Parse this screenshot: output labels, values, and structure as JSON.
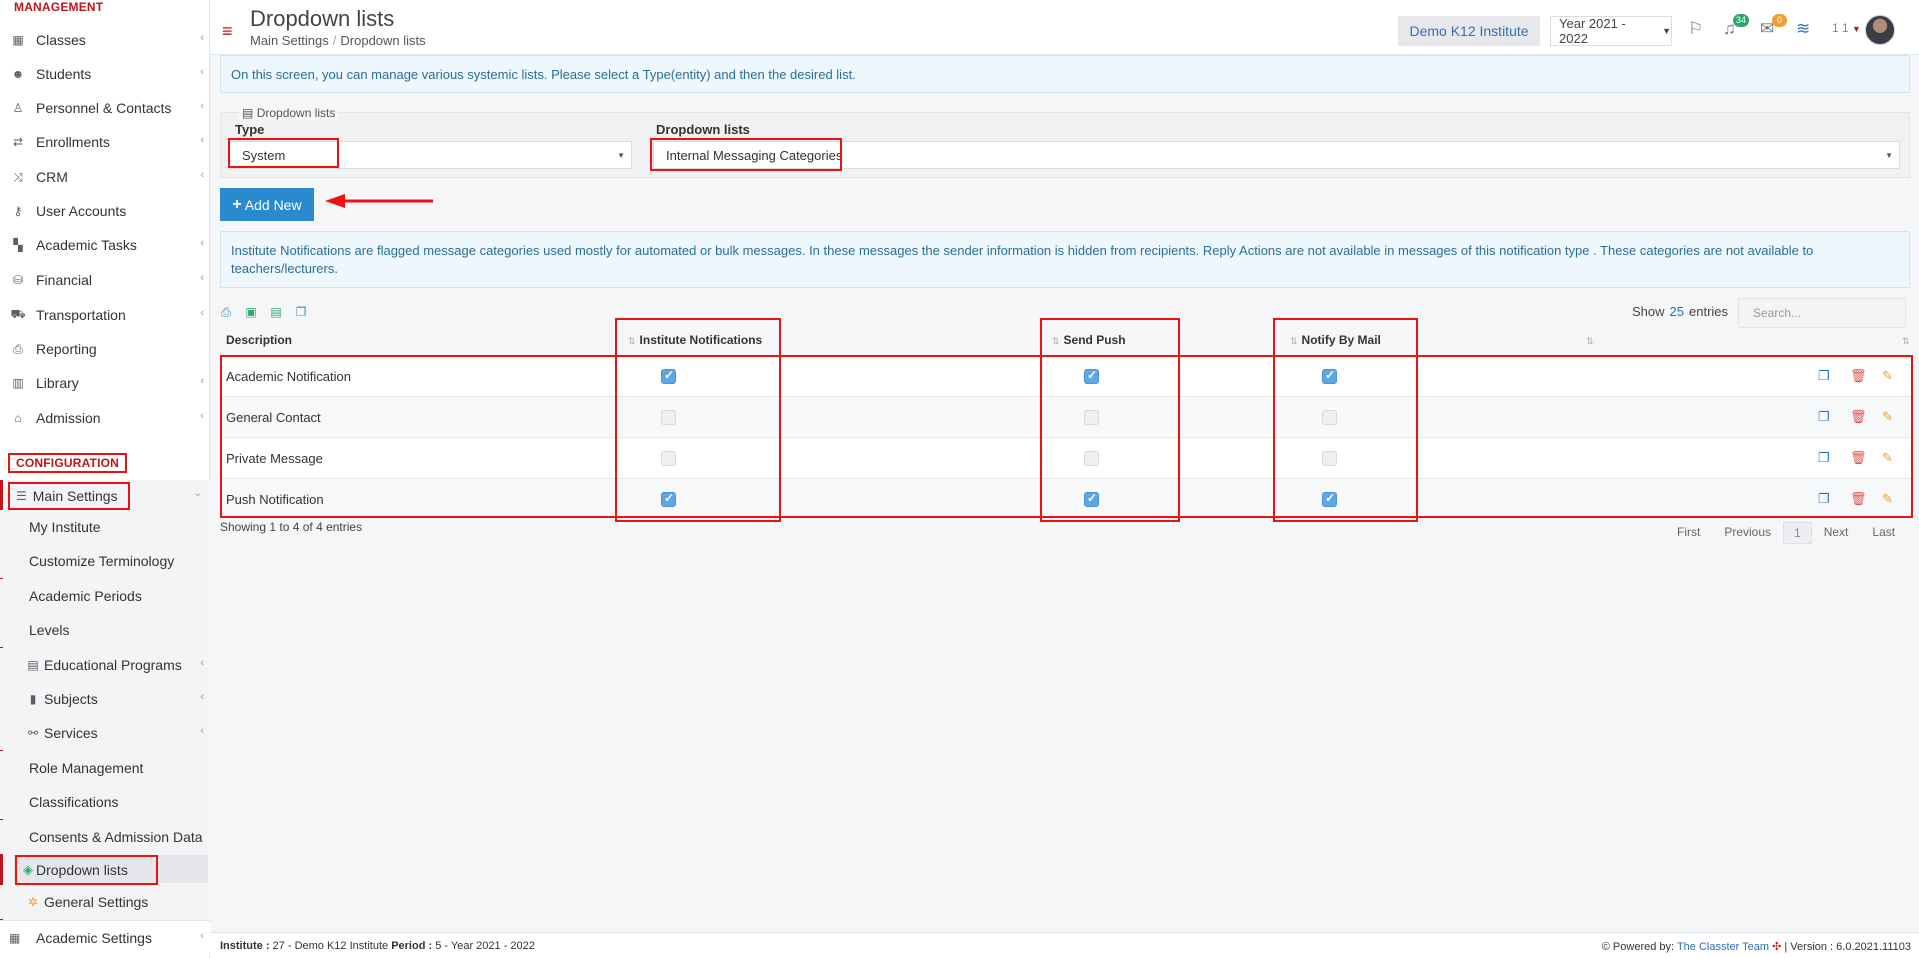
{
  "sidebar": {
    "management_label": "MANAGEMENT",
    "items": [
      {
        "label": "Classes",
        "icon": "classes-icon",
        "chev": "‹"
      },
      {
        "label": "Students",
        "icon": "students-icon",
        "chev": "‹"
      },
      {
        "label": "Personnel & Contacts",
        "icon": "person-icon",
        "chev": "‹"
      },
      {
        "label": "Enrollments",
        "icon": "exchange-icon",
        "chev": "‹"
      },
      {
        "label": "CRM",
        "icon": "crm-icon",
        "chev": "‹"
      },
      {
        "label": "User Accounts",
        "icon": "key-icon",
        "chev": ""
      },
      {
        "label": "Academic Tasks",
        "icon": "grid-icon",
        "chev": "‹"
      },
      {
        "label": "Financial",
        "icon": "money-icon",
        "chev": "‹"
      },
      {
        "label": "Transportation",
        "icon": "bus-icon",
        "chev": "‹"
      },
      {
        "label": "Reporting",
        "icon": "printer-icon",
        "chev": ""
      },
      {
        "label": "Library",
        "icon": "library-icon",
        "chev": "‹"
      },
      {
        "label": "Admission",
        "icon": "bank-icon",
        "chev": "‹"
      }
    ],
    "configuration_label": "CONFIGURATION",
    "main_settings_label": "Main Settings",
    "sub_items": [
      {
        "label": "My Institute",
        "chev": ""
      },
      {
        "label": "Customize Terminology",
        "chev": ""
      },
      {
        "label": "Academic Periods",
        "chev": ""
      },
      {
        "label": "Levels",
        "chev": ""
      },
      {
        "label": "Educational Programs",
        "chev": "‹"
      },
      {
        "label": "Subjects",
        "chev": "‹"
      },
      {
        "label": "Services",
        "chev": "‹"
      },
      {
        "label": "Role Management",
        "chev": ""
      },
      {
        "label": "Classifications",
        "chev": ""
      },
      {
        "label": "Consents & Admission Data",
        "chev": ""
      }
    ],
    "active_item": "Dropdown lists",
    "general_settings": "General Settings",
    "academic_settings": "Academic Settings"
  },
  "header": {
    "title": "Dropdown lists",
    "breadcrumb": [
      "Main Settings",
      "Dropdown lists"
    ],
    "institute": "Demo K12 Institute",
    "year": "Year 2021 - 2022",
    "notif_count": "34",
    "mail_count": "0",
    "user_num": "1 1"
  },
  "info_text": "On this screen, you can manage various systemic lists. Please select a Type(entity) and then the desired list.",
  "filters": {
    "legend": "Dropdown lists",
    "type_label": "Type",
    "type_value": "System",
    "list_label": "Dropdown lists",
    "list_value": "Internal Messaging Categories"
  },
  "add_new_label": "Add New",
  "info_text2": "Institute Notifications are flagged message categories used mostly for automated or bulk messages. In these messages the sender information is hidden from recipients. Reply Actions are not available in messages of this notification type . These categories are not available to teachers/lecturers.",
  "table": {
    "show_label": "Show",
    "show_count": "25",
    "entries_label": "entries",
    "search_placeholder": "Search...",
    "columns": [
      "Description",
      "Institute Notifications",
      "Send Push",
      "Notify By Mail"
    ],
    "rows": [
      {
        "desc": "Academic Notification",
        "inst": true,
        "push": true,
        "mail": true
      },
      {
        "desc": "General Contact",
        "inst": false,
        "push": false,
        "mail": false
      },
      {
        "desc": "Private Message",
        "inst": false,
        "push": false,
        "mail": false
      },
      {
        "desc": "Push Notification",
        "inst": true,
        "push": true,
        "mail": true
      }
    ],
    "showing": "Showing 1 to 4 of 4 entries",
    "pager": [
      "First",
      "Previous",
      "1",
      "Next",
      "Last"
    ]
  },
  "footer": {
    "institute_label": "Institute :",
    "institute_value": "27 - Demo K12 Institute",
    "period_label": "Period :",
    "period_value": "5 - Year 2021 - 2022",
    "powered_label": "Powered by:",
    "powered_link": "The Classter Team",
    "version": "| Version : 6.0.2021.11103"
  },
  "colors": {
    "accent": "#c0141c",
    "button": "#2a8ad0",
    "info_bg": "#eef7fb",
    "check": "#5fa6e4"
  }
}
